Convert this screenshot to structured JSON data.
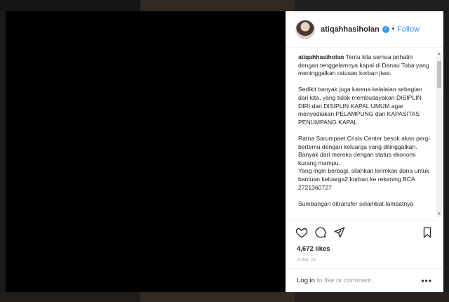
{
  "header": {
    "username": "atiqahhasiholan",
    "separator": "•",
    "follow_label": "Follow"
  },
  "caption": {
    "username": "atiqahhasiholan",
    "text": " Tentu kita semua prihatin dengan tenggelamnya kapal di Danau Toba yang meninggalkan ratusan korban jiwa.\n\nSedikit banyak juga karena kelalaian sebagian dari kita, yang tidak membudayakan DISIPLIN DIRI dan DISIPLIN KAPAL UMUM agar menyediakan PELAMPUNG dan KAPASITAS PENUMPANG KAPAL.\n\nRatna Sarumpaet Crisis Center besok akan pergi bertemu dengan keluarga yang ditinggalkan. Banyak dari mereka dengan status ekonomi kurang mampu.\nYang ingin berbagi, silahkan kirimkan dana untuk bantuan keluarga2 korban ke rekening BCA 2721360727\n\nSumbangan ditransfer selambat-lambatnya"
  },
  "likes": "4,672 likes",
  "date": "JUNE 29",
  "comment_bar": {
    "login_label": "Log in",
    "suffix": " to like or comment.",
    "more": "•••"
  },
  "icons": {
    "verified": "verified-badge-icon",
    "like": "heart-icon",
    "comment": "comment-icon",
    "share": "share-icon",
    "save": "bookmark-icon",
    "more": "more-options-icon"
  },
  "colors": {
    "link_blue": "#3897f0",
    "text": "#262626",
    "muted": "#999999"
  }
}
